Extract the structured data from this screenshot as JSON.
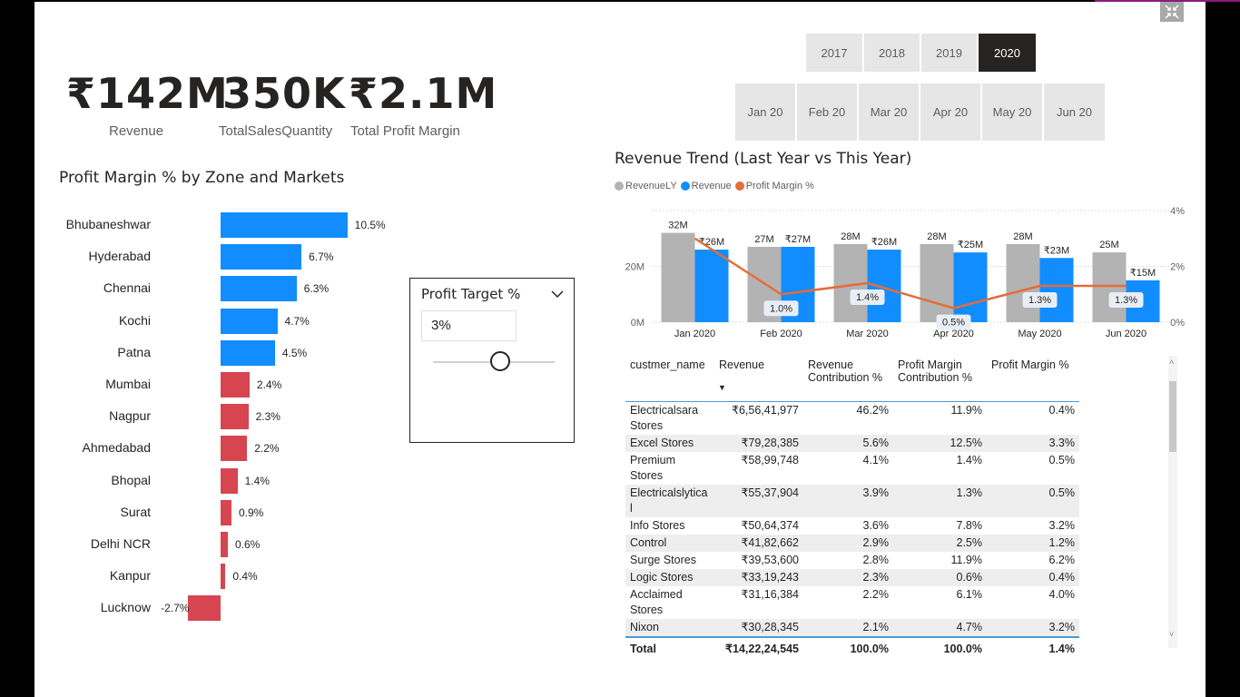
{
  "kpis": [
    {
      "value": "₹142M",
      "label": "Revenue"
    },
    {
      "value": "350K",
      "label": "TotalSalesQuantity"
    },
    {
      "value": "₹2.1M",
      "label": "Total Profit Margin"
    }
  ],
  "years": {
    "items": [
      "2017",
      "2018",
      "2019",
      "2020"
    ],
    "selected": "2020"
  },
  "months": {
    "items": [
      "Jan 20",
      "Feb 20",
      "Mar 20",
      "Apr 20",
      "May 20",
      "Jun 20"
    ]
  },
  "zone_chart": {
    "title": "Profit Margin % by Zone and Markets",
    "colors": {
      "above": "#118dff",
      "below": "#d64550"
    },
    "items": [
      {
        "name": "Bhubaneshwar",
        "value": 10.5,
        "label": "10.5%"
      },
      {
        "name": "Hyderabad",
        "value": 6.7,
        "label": "6.7%"
      },
      {
        "name": "Chennai",
        "value": 6.3,
        "label": "6.3%"
      },
      {
        "name": "Kochi",
        "value": 4.7,
        "label": "4.7%"
      },
      {
        "name": "Patna",
        "value": 4.5,
        "label": "4.5%"
      },
      {
        "name": "Mumbai",
        "value": 2.4,
        "label": "2.4%"
      },
      {
        "name": "Nagpur",
        "value": 2.3,
        "label": "2.3%"
      },
      {
        "name": "Ahmedabad",
        "value": 2.2,
        "label": "2.2%"
      },
      {
        "name": "Bhopal",
        "value": 1.4,
        "label": "1.4%"
      },
      {
        "name": "Surat",
        "value": 0.9,
        "label": "0.9%"
      },
      {
        "name": "Delhi NCR",
        "value": 0.6,
        "label": "0.6%"
      },
      {
        "name": "Kanpur",
        "value": 0.4,
        "label": "0.4%"
      },
      {
        "name": "Lucknow",
        "value": -2.7,
        "label": "-2.7%"
      }
    ]
  },
  "profit_target": {
    "title": "Profit Target %",
    "value": "3%",
    "slider_fraction": 0.55
  },
  "chart_data": {
    "type": "bar",
    "title": "Revenue Trend (Last Year vs This Year)",
    "categories": [
      "Jan 2020",
      "Feb 2020",
      "Mar 2020",
      "Apr 2020",
      "May 2020",
      "Jun 2020"
    ],
    "series": [
      {
        "name": "RevenueLY",
        "color": "#b3b3b3",
        "values": [
          32,
          27,
          28,
          28,
          28,
          25
        ],
        "labels": [
          "32M",
          "27M",
          "28M",
          "28M",
          "28M",
          "25M"
        ]
      },
      {
        "name": "Revenue",
        "color": "#118dff",
        "values": [
          26,
          27,
          26,
          25,
          23,
          15
        ],
        "labels": [
          "₹26M",
          "₹27M",
          "₹26M",
          "₹25M",
          "₹23M",
          "₹15M"
        ]
      },
      {
        "name": "Profit Margin %",
        "color": "#e66c37",
        "type": "line",
        "axis": "right",
        "values": [
          3.0,
          1.0,
          1.4,
          0.5,
          1.3,
          1.3
        ],
        "labels": [
          "",
          "1.0%",
          "1.4%",
          "0.5%",
          "1.3%",
          "1.3%"
        ]
      }
    ],
    "ylim": [
      0,
      40
    ],
    "y_ticks": [
      "0M",
      "20M"
    ],
    "y2lim": [
      0,
      4
    ],
    "y2_ticks": [
      "0%",
      "2%",
      "4%"
    ],
    "legend": "top-left",
    "grid": true
  },
  "table": {
    "columns": [
      "custmer_name",
      "Revenue",
      "Revenue Contribution %",
      "Profit Margin Contribution %",
      "Profit Margin %"
    ],
    "rows": [
      [
        "Electricalsara Stores",
        "₹6,56,41,977",
        "46.2%",
        "11.9%",
        "0.4%"
      ],
      [
        "Excel Stores",
        "₹79,28,385",
        "5.6%",
        "12.5%",
        "3.3%"
      ],
      [
        "Premium Stores",
        "₹58,99,748",
        "4.1%",
        "1.4%",
        "0.5%"
      ],
      [
        "Electricalslytica l",
        "₹55,37,904",
        "3.9%",
        "1.3%",
        "0.5%"
      ],
      [
        "Info Stores",
        "₹50,64,374",
        "3.6%",
        "7.8%",
        "3.2%"
      ],
      [
        "Control",
        "₹41,82,662",
        "2.9%",
        "2.5%",
        "1.2%"
      ],
      [
        "Surge Stores",
        "₹39,53,600",
        "2.8%",
        "11.9%",
        "6.2%"
      ],
      [
        "Logic Stores",
        "₹33,19,243",
        "2.3%",
        "0.6%",
        "0.4%"
      ],
      [
        "Acclaimed Stores",
        "₹31,16,384",
        "2.2%",
        "6.1%",
        "4.0%"
      ],
      [
        "Nixon",
        "₹30,28,345",
        "2.1%",
        "4.7%",
        "3.2%"
      ]
    ],
    "total": [
      "Total",
      "₹14,22,24,545",
      "100.0%",
      "100.0%",
      "1.4%"
    ]
  }
}
